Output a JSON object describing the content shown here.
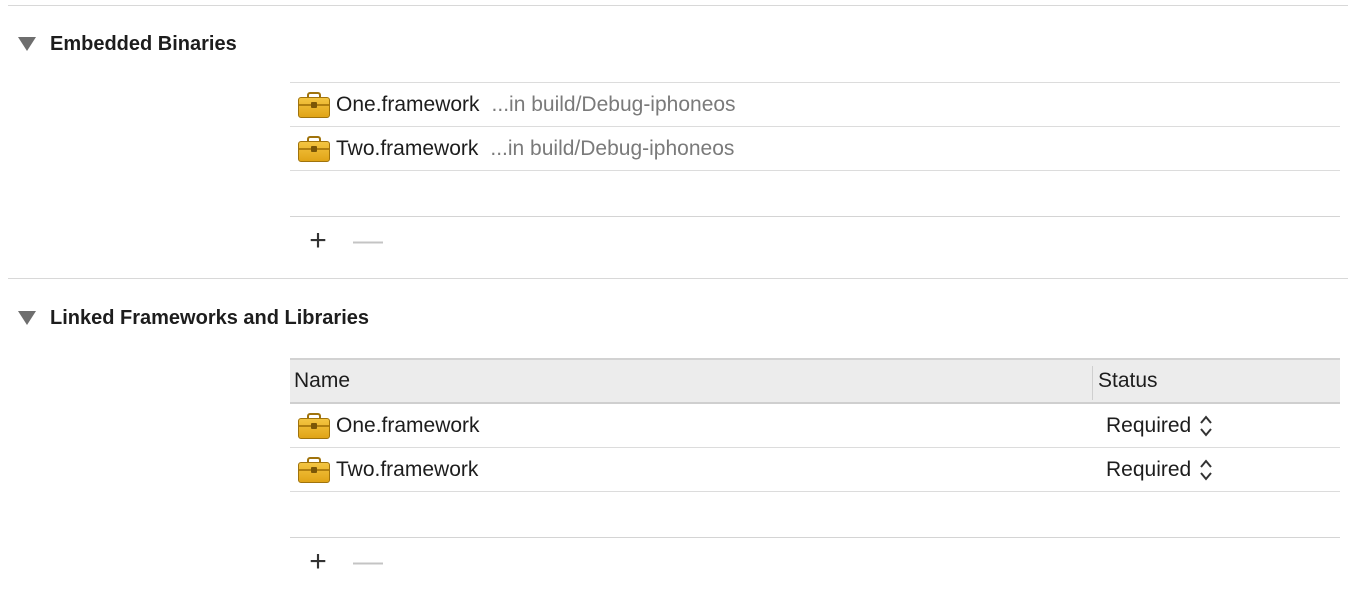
{
  "embedded": {
    "title": "Embedded Binaries",
    "items": [
      {
        "name": "One.framework",
        "path": "...in build/Debug-iphoneos"
      },
      {
        "name": "Two.framework",
        "path": "...in build/Debug-iphoneos"
      }
    ],
    "add_label": "+",
    "remove_label": "—"
  },
  "linked": {
    "title": "Linked Frameworks and Libraries",
    "columns": {
      "name": "Name",
      "status": "Status"
    },
    "items": [
      {
        "name": "One.framework",
        "status": "Required"
      },
      {
        "name": "Two.framework",
        "status": "Required"
      }
    ],
    "add_label": "+",
    "remove_label": "—"
  },
  "icons": {
    "disclosure": "disclosure-triangle-down",
    "framework": "toolbox-icon",
    "stepper": "up-down-chevron-icon"
  },
  "colors": {
    "framework_icon": "#e8ad22",
    "secondary_text": "#7a7a7a"
  }
}
